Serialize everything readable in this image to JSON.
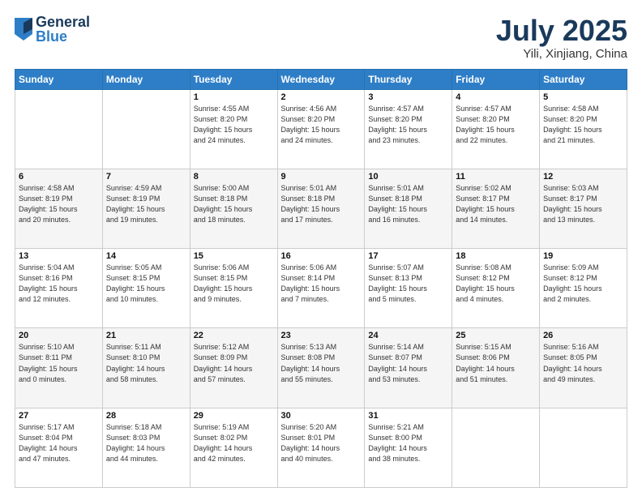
{
  "header": {
    "logo": {
      "general": "General",
      "blue": "Blue"
    },
    "title": "July 2025",
    "location": "Yili, Xinjiang, China"
  },
  "weekdays": [
    "Sunday",
    "Monday",
    "Tuesday",
    "Wednesday",
    "Thursday",
    "Friday",
    "Saturday"
  ],
  "weeks": [
    [
      {
        "day": "",
        "content": ""
      },
      {
        "day": "",
        "content": ""
      },
      {
        "day": "1",
        "content": "Sunrise: 4:55 AM\nSunset: 8:20 PM\nDaylight: 15 hours\nand 24 minutes."
      },
      {
        "day": "2",
        "content": "Sunrise: 4:56 AM\nSunset: 8:20 PM\nDaylight: 15 hours\nand 24 minutes."
      },
      {
        "day": "3",
        "content": "Sunrise: 4:57 AM\nSunset: 8:20 PM\nDaylight: 15 hours\nand 23 minutes."
      },
      {
        "day": "4",
        "content": "Sunrise: 4:57 AM\nSunset: 8:20 PM\nDaylight: 15 hours\nand 22 minutes."
      },
      {
        "day": "5",
        "content": "Sunrise: 4:58 AM\nSunset: 8:20 PM\nDaylight: 15 hours\nand 21 minutes."
      }
    ],
    [
      {
        "day": "6",
        "content": "Sunrise: 4:58 AM\nSunset: 8:19 PM\nDaylight: 15 hours\nand 20 minutes."
      },
      {
        "day": "7",
        "content": "Sunrise: 4:59 AM\nSunset: 8:19 PM\nDaylight: 15 hours\nand 19 minutes."
      },
      {
        "day": "8",
        "content": "Sunrise: 5:00 AM\nSunset: 8:18 PM\nDaylight: 15 hours\nand 18 minutes."
      },
      {
        "day": "9",
        "content": "Sunrise: 5:01 AM\nSunset: 8:18 PM\nDaylight: 15 hours\nand 17 minutes."
      },
      {
        "day": "10",
        "content": "Sunrise: 5:01 AM\nSunset: 8:18 PM\nDaylight: 15 hours\nand 16 minutes."
      },
      {
        "day": "11",
        "content": "Sunrise: 5:02 AM\nSunset: 8:17 PM\nDaylight: 15 hours\nand 14 minutes."
      },
      {
        "day": "12",
        "content": "Sunrise: 5:03 AM\nSunset: 8:17 PM\nDaylight: 15 hours\nand 13 minutes."
      }
    ],
    [
      {
        "day": "13",
        "content": "Sunrise: 5:04 AM\nSunset: 8:16 PM\nDaylight: 15 hours\nand 12 minutes."
      },
      {
        "day": "14",
        "content": "Sunrise: 5:05 AM\nSunset: 8:15 PM\nDaylight: 15 hours\nand 10 minutes."
      },
      {
        "day": "15",
        "content": "Sunrise: 5:06 AM\nSunset: 8:15 PM\nDaylight: 15 hours\nand 9 minutes."
      },
      {
        "day": "16",
        "content": "Sunrise: 5:06 AM\nSunset: 8:14 PM\nDaylight: 15 hours\nand 7 minutes."
      },
      {
        "day": "17",
        "content": "Sunrise: 5:07 AM\nSunset: 8:13 PM\nDaylight: 15 hours\nand 5 minutes."
      },
      {
        "day": "18",
        "content": "Sunrise: 5:08 AM\nSunset: 8:12 PM\nDaylight: 15 hours\nand 4 minutes."
      },
      {
        "day": "19",
        "content": "Sunrise: 5:09 AM\nSunset: 8:12 PM\nDaylight: 15 hours\nand 2 minutes."
      }
    ],
    [
      {
        "day": "20",
        "content": "Sunrise: 5:10 AM\nSunset: 8:11 PM\nDaylight: 15 hours\nand 0 minutes."
      },
      {
        "day": "21",
        "content": "Sunrise: 5:11 AM\nSunset: 8:10 PM\nDaylight: 14 hours\nand 58 minutes."
      },
      {
        "day": "22",
        "content": "Sunrise: 5:12 AM\nSunset: 8:09 PM\nDaylight: 14 hours\nand 57 minutes."
      },
      {
        "day": "23",
        "content": "Sunrise: 5:13 AM\nSunset: 8:08 PM\nDaylight: 14 hours\nand 55 minutes."
      },
      {
        "day": "24",
        "content": "Sunrise: 5:14 AM\nSunset: 8:07 PM\nDaylight: 14 hours\nand 53 minutes."
      },
      {
        "day": "25",
        "content": "Sunrise: 5:15 AM\nSunset: 8:06 PM\nDaylight: 14 hours\nand 51 minutes."
      },
      {
        "day": "26",
        "content": "Sunrise: 5:16 AM\nSunset: 8:05 PM\nDaylight: 14 hours\nand 49 minutes."
      }
    ],
    [
      {
        "day": "27",
        "content": "Sunrise: 5:17 AM\nSunset: 8:04 PM\nDaylight: 14 hours\nand 47 minutes."
      },
      {
        "day": "28",
        "content": "Sunrise: 5:18 AM\nSunset: 8:03 PM\nDaylight: 14 hours\nand 44 minutes."
      },
      {
        "day": "29",
        "content": "Sunrise: 5:19 AM\nSunset: 8:02 PM\nDaylight: 14 hours\nand 42 minutes."
      },
      {
        "day": "30",
        "content": "Sunrise: 5:20 AM\nSunset: 8:01 PM\nDaylight: 14 hours\nand 40 minutes."
      },
      {
        "day": "31",
        "content": "Sunrise: 5:21 AM\nSunset: 8:00 PM\nDaylight: 14 hours\nand 38 minutes."
      },
      {
        "day": "",
        "content": ""
      },
      {
        "day": "",
        "content": ""
      }
    ]
  ]
}
